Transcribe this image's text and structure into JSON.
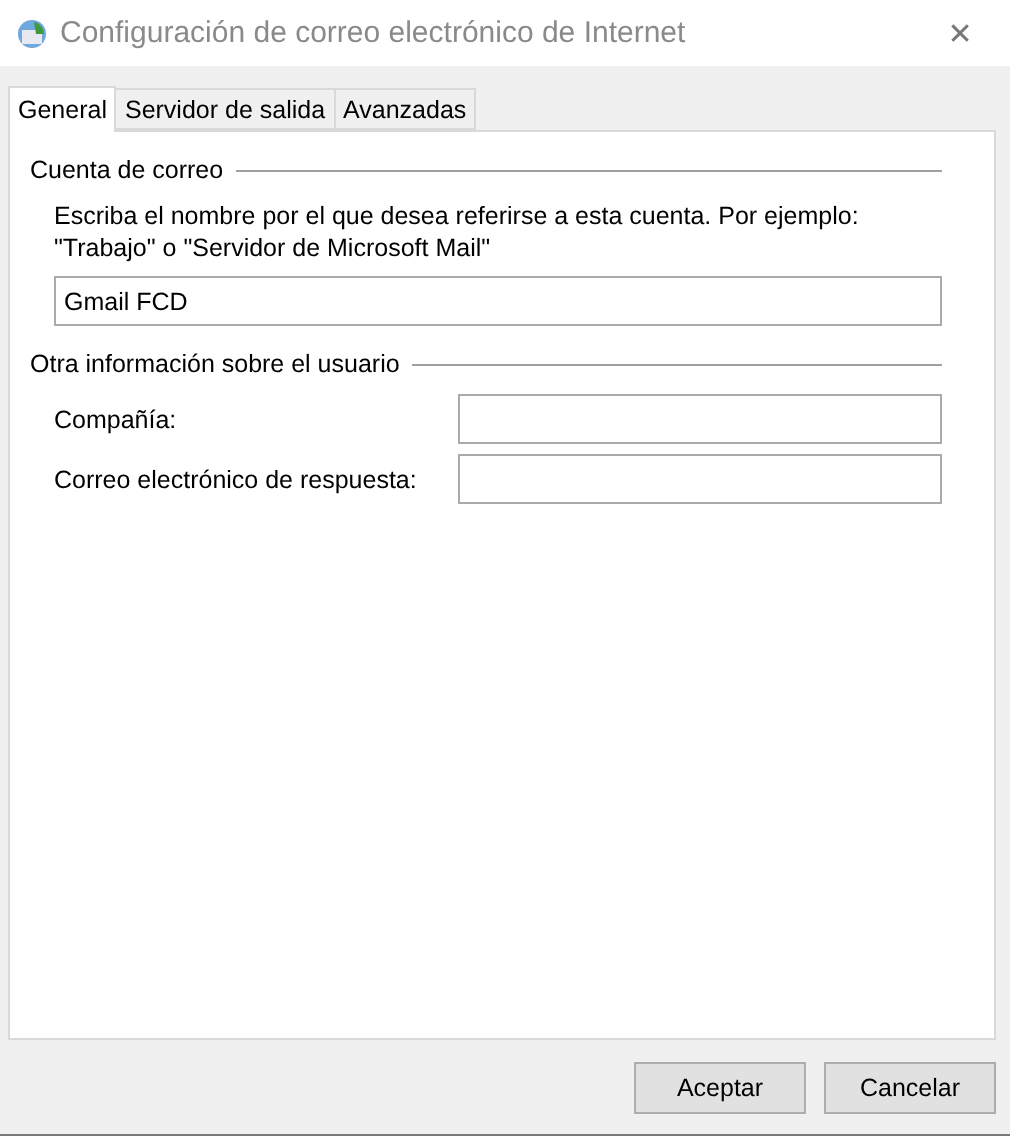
{
  "window": {
    "title": "Configuración de correo electrónico de Internet",
    "close": "✕"
  },
  "tabs": [
    {
      "label": "General",
      "selected": true
    },
    {
      "label": "Servidor de salida",
      "selected": false
    },
    {
      "label": "Avanzadas",
      "selected": false
    }
  ],
  "groups": [
    {
      "title": "Cuenta de correo",
      "description": "Escriba el nombre por el que desea referirse a esta cuenta. Por ejemplo: \"Trabajo\" o \"Servidor de Microsoft Mail\"",
      "fields": [
        {
          "value": "Gmail FCD"
        }
      ]
    },
    {
      "title": "Otra información sobre el usuario",
      "fields": [
        {
          "label": "Compañía:"
        },
        {
          "label": "Correo electrónico de respuesta:"
        }
      ]
    }
  ],
  "buttons": [
    "Aceptar",
    "Cancelar"
  ]
}
